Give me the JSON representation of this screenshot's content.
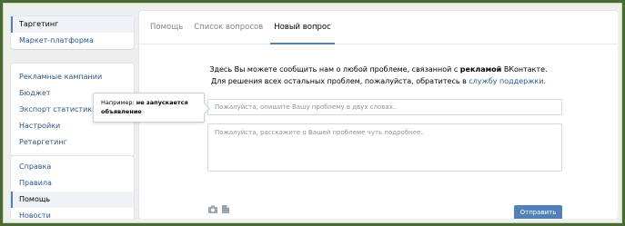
{
  "sidebar": {
    "group1": [
      {
        "label": "Таргетинг",
        "active": true
      },
      {
        "label": "Маркет-платформа"
      }
    ],
    "group2": [
      {
        "label": "Рекламные кампании"
      },
      {
        "label": "Бюджет"
      },
      {
        "label": "Экспорт статистики"
      },
      {
        "label": "Настройки"
      },
      {
        "label": "Ретаргетинг"
      }
    ],
    "group3": [
      {
        "label": "Справка"
      },
      {
        "label": "Правила"
      },
      {
        "label": "Помощь",
        "active": true
      },
      {
        "label": "Новости"
      }
    ]
  },
  "tabs": [
    {
      "label": "Помощь"
    },
    {
      "label": "Список вопросов"
    },
    {
      "label": "Новый вопрос",
      "active": true
    }
  ],
  "intro": {
    "line1_pre": "Здесь Вы можете сообщить нам о любой проблеме, связанной с ",
    "line1_bold": "рекламой",
    "line1_post": " ВКонтакте.",
    "line2_pre": "Для решения всех остальных проблем, пожалуйста, обратитесь в ",
    "line2_link": "службу поддержки",
    "line2_post": "."
  },
  "form": {
    "title_placeholder": "Пожалуйста, опишите Вашу проблему в двух словах..",
    "desc_placeholder": "Пожалуйста, расскажите о Вашей проблеме чуть подробнее..",
    "send_label": "Отправить"
  },
  "tooltip": {
    "prefix": "Например: ",
    "bold1": "не запускается",
    "bold2": "объявление"
  },
  "icons": {
    "camera": "camera-icon",
    "document": "document-icon"
  },
  "colors": {
    "accent": "#5181b8",
    "link": "#2a5885",
    "frame": "#4a6a34"
  }
}
